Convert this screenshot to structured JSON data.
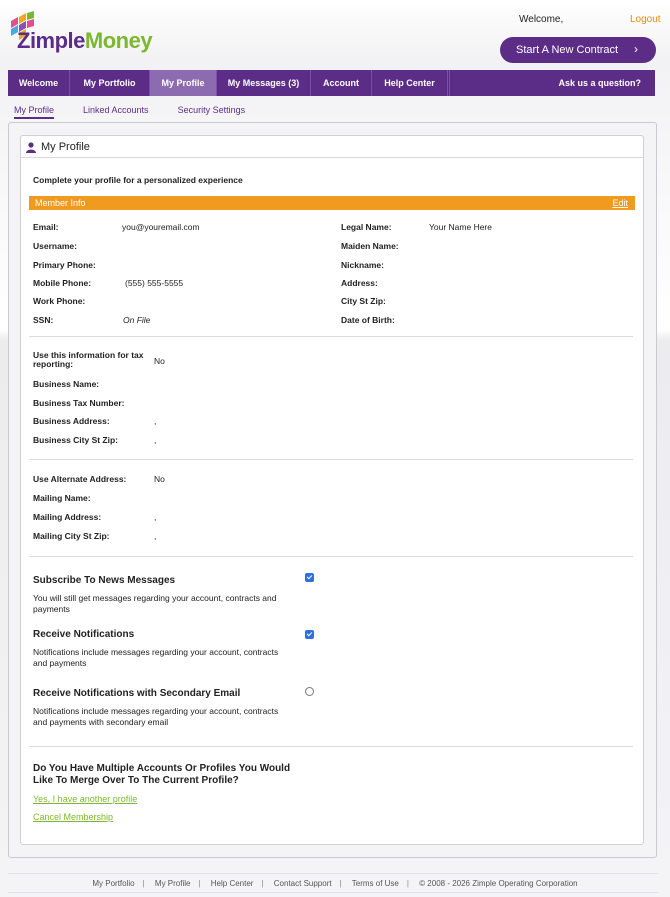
{
  "brand": {
    "name_part1": "Zimple",
    "name_part2": "Money",
    "colors": {
      "purple": "#5b2d86",
      "green": "#7cb82f",
      "orange": "#f09a1f"
    }
  },
  "header": {
    "welcome": "Welcome,",
    "logout": "Logout",
    "start_contract": "Start A New Contract"
  },
  "nav": {
    "items": [
      "Welcome",
      "My Portfolio",
      "My Profile",
      "My Messages (3)",
      "Account",
      "Help Center"
    ],
    "active": "My Profile",
    "ask": "Ask us a question?"
  },
  "subnav": {
    "items": [
      "My Profile",
      "Linked Accounts",
      "Security Settings"
    ],
    "active": "My Profile"
  },
  "card": {
    "title": "My Profile",
    "intro": "Complete your profile for a personalized experience"
  },
  "member_info": {
    "title": "Member Info",
    "edit": "Edit",
    "left": [
      {
        "label": "Email:",
        "value": "you@youremail.com",
        "italic": false
      },
      {
        "label": "Username:",
        "value": "",
        "italic": false
      },
      {
        "label": "Primary Phone:",
        "value": "",
        "italic": false
      },
      {
        "label": "Mobile Phone:",
        "value": "(555) 555-5555",
        "italic": false
      },
      {
        "label": "Work Phone:",
        "value": "",
        "italic": false
      },
      {
        "label": "SSN:",
        "value": "On File",
        "italic": true
      }
    ],
    "right": [
      {
        "label": "Legal Name:",
        "value": "Your Name Here"
      },
      {
        "label": "Maiden Name:",
        "value": ""
      },
      {
        "label": "Nickname:",
        "value": ""
      },
      {
        "label": "Address:",
        "value": ""
      },
      {
        "label": "City St Zip:",
        "value": ""
      },
      {
        "label": "Date of Birth:",
        "value": ""
      }
    ]
  },
  "business": {
    "tax_label": "Use this information for tax reporting:",
    "tax_value": "No",
    "rows": [
      {
        "label": "Business Name:",
        "value": ""
      },
      {
        "label": "Business Tax Number:",
        "value": ""
      },
      {
        "label": "Business Address:",
        "value": ","
      },
      {
        "label": "Business City St Zip:",
        "value": ","
      }
    ]
  },
  "mailing": {
    "rows": [
      {
        "label": "Use Alternate Address:",
        "value": "No"
      },
      {
        "label": "Mailing Name:",
        "value": ""
      },
      {
        "label": "Mailing Address:",
        "value": ","
      },
      {
        "label": "Mailing City St Zip:",
        "value": ","
      }
    ]
  },
  "preferences": [
    {
      "title": "Subscribe To News Messages",
      "desc": "You will still get messages regarding your account, contracts and payments",
      "checked": true
    },
    {
      "title": "Receive Notifications",
      "desc": "Notifications include messages regarding your account, contracts and payments",
      "checked": true
    },
    {
      "title": "Receive Notifications with Secondary Email",
      "desc": "Notifications include messages regarding your account, contracts and payments with secondary email",
      "checked": false
    }
  ],
  "merge": {
    "question": "Do You Have Multiple Accounts Or Profiles You Would Like To Merge Over To The Current Profile?",
    "link_other": "Yes, I have another profile",
    "link_cancel": "Cancel Membership"
  },
  "footer": {
    "links": [
      "My Portfolio",
      "My Profile",
      "Help Center",
      "Contact Support",
      "Terms of Use"
    ],
    "copyright": "© 2008 - 2026 Zimple Operating Corporation"
  }
}
